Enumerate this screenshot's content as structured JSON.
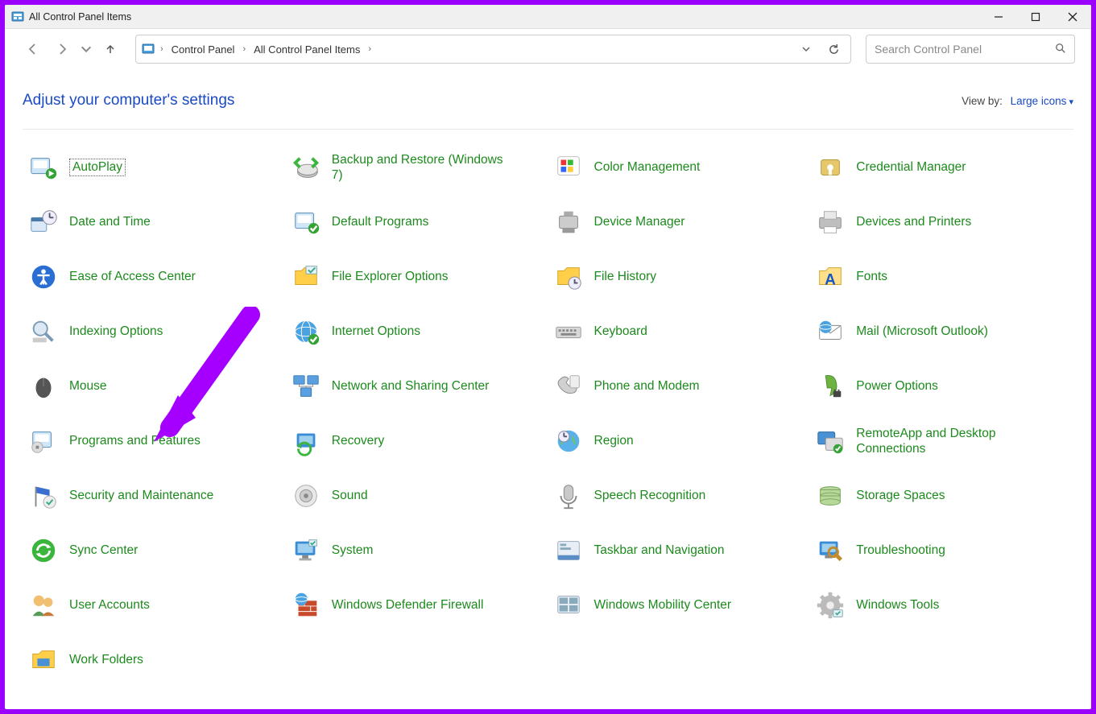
{
  "window": {
    "title": "All Control Panel Items"
  },
  "breadcrumb": {
    "seg1": "Control Panel",
    "seg2": "All Control Panel Items"
  },
  "search": {
    "placeholder": "Search Control Panel"
  },
  "heading": "Adjust your computer's settings",
  "viewby": {
    "label": "View by:",
    "value": "Large icons"
  },
  "items": [
    {
      "label": "AutoPlay",
      "selected": true
    },
    {
      "label": "Backup and Restore (Windows 7)"
    },
    {
      "label": "Color Management"
    },
    {
      "label": "Credential Manager"
    },
    {
      "label": "Date and Time"
    },
    {
      "label": "Default Programs"
    },
    {
      "label": "Device Manager"
    },
    {
      "label": "Devices and Printers"
    },
    {
      "label": "Ease of Access Center"
    },
    {
      "label": "File Explorer Options"
    },
    {
      "label": "File History"
    },
    {
      "label": "Fonts"
    },
    {
      "label": "Indexing Options"
    },
    {
      "label": "Internet Options"
    },
    {
      "label": "Keyboard"
    },
    {
      "label": "Mail (Microsoft Outlook)"
    },
    {
      "label": "Mouse"
    },
    {
      "label": "Network and Sharing Center"
    },
    {
      "label": "Phone and Modem"
    },
    {
      "label": "Power Options"
    },
    {
      "label": "Programs and Features"
    },
    {
      "label": "Recovery"
    },
    {
      "label": "Region"
    },
    {
      "label": "RemoteApp and Desktop Connections"
    },
    {
      "label": "Security and Maintenance"
    },
    {
      "label": "Sound"
    },
    {
      "label": "Speech Recognition"
    },
    {
      "label": "Storage Spaces"
    },
    {
      "label": "Sync Center"
    },
    {
      "label": "System"
    },
    {
      "label": "Taskbar and Navigation"
    },
    {
      "label": "Troubleshooting"
    },
    {
      "label": "User Accounts"
    },
    {
      "label": "Windows Defender Firewall"
    },
    {
      "label": "Windows Mobility Center"
    },
    {
      "label": "Windows Tools"
    },
    {
      "label": "Work Folders"
    }
  ],
  "icons": [
    "autoplay",
    "backup",
    "color",
    "credential",
    "datetime",
    "defaultprog",
    "devicemgr",
    "devprint",
    "ease",
    "fileexp",
    "filehist",
    "fonts",
    "indexing",
    "internet",
    "keyboard",
    "mail",
    "mouse",
    "network",
    "phone",
    "power",
    "programs",
    "recovery",
    "region",
    "remoteapp",
    "security",
    "sound",
    "speech",
    "storage",
    "sync",
    "system",
    "taskbar",
    "trouble",
    "users",
    "firewall",
    "mobility",
    "wintools",
    "workfolders"
  ]
}
